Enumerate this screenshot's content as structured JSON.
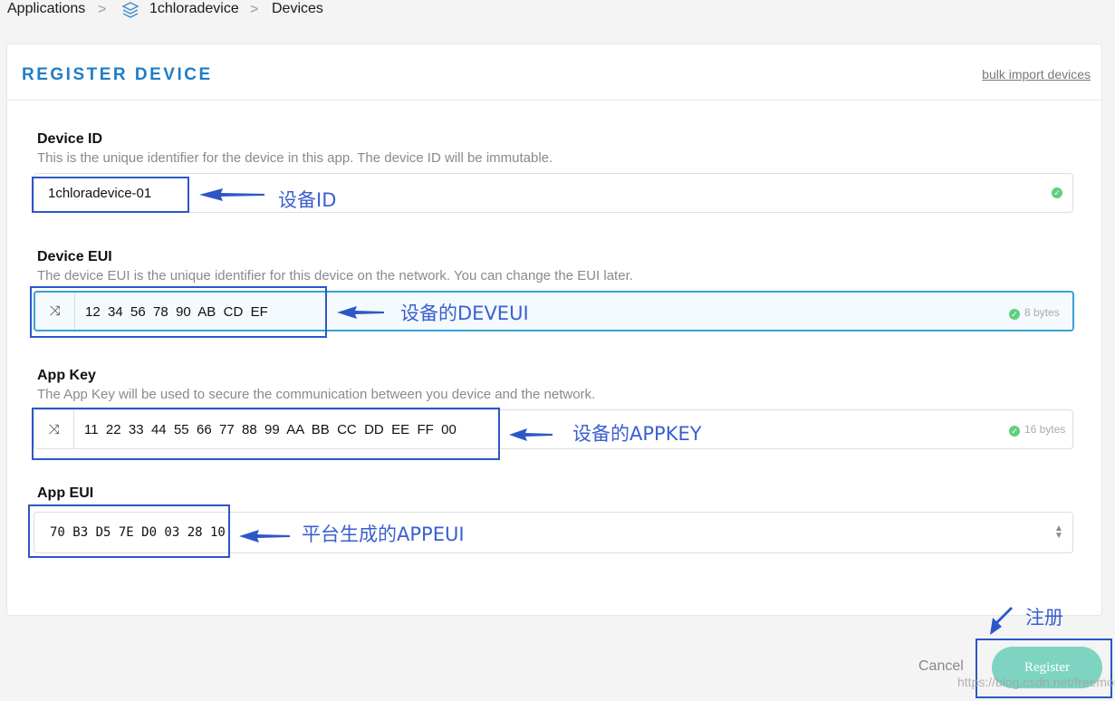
{
  "breadcrumb": {
    "items": [
      "Applications",
      "1chloradevice",
      "Devices"
    ],
    "separator": ">"
  },
  "card": {
    "title": "REGISTER DEVICE",
    "bulk_link": "bulk import devices"
  },
  "fields": {
    "device_id": {
      "label": "Device ID",
      "description": "This is the unique identifier for the device in this app. The device ID will be immutable.",
      "value": "1chloradevice-01",
      "valid": true
    },
    "device_eui": {
      "label": "Device EUI",
      "description": "The device EUI is the unique identifier for this device on the network. You can change the EUI later.",
      "value": "12  34  56  78  90  AB  CD  EF",
      "bytes": "8 bytes",
      "valid": true
    },
    "app_key": {
      "label": "App Key",
      "description": "The App Key will be used to secure the communication between you device and the network.",
      "value": "11  22  33  44  55  66  77  88  99  AA  BB  CC  DD  EE  FF  00",
      "bytes": "16 bytes",
      "valid": true
    },
    "app_eui": {
      "label": "App EUI",
      "value": "70 B3 D5 7E D0 03 28 10"
    }
  },
  "annotations": {
    "device_id": "设备ID",
    "device_eui": "设备的DEVEUI",
    "app_key": "设备的APPKEY",
    "app_eui": "平台生成的APPEUI",
    "register": "注册"
  },
  "actions": {
    "cancel": "Cancel",
    "register": "Register"
  },
  "watermark": "https://blog.csdn.net/freemote",
  "colors": {
    "accent": "#1f7dc7",
    "register_button": "#7dd5c1",
    "annotation": "#2d57c7",
    "valid": "#5fcf80"
  }
}
